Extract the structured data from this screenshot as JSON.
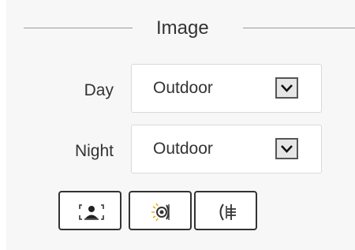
{
  "section": {
    "title": "Image"
  },
  "day": {
    "label": "Day",
    "value": "Outdoor"
  },
  "night": {
    "label": "Night",
    "value": "Outdoor"
  },
  "icons": {
    "dropdown": "chevron-down-icon",
    "tools": [
      "backlight-person-icon",
      "noise-reduction-icon",
      "ir-light-icon"
    ]
  },
  "colors": {
    "panel_bg": "#f7f7f7",
    "border": "#d9d9d9",
    "text": "#333333"
  }
}
